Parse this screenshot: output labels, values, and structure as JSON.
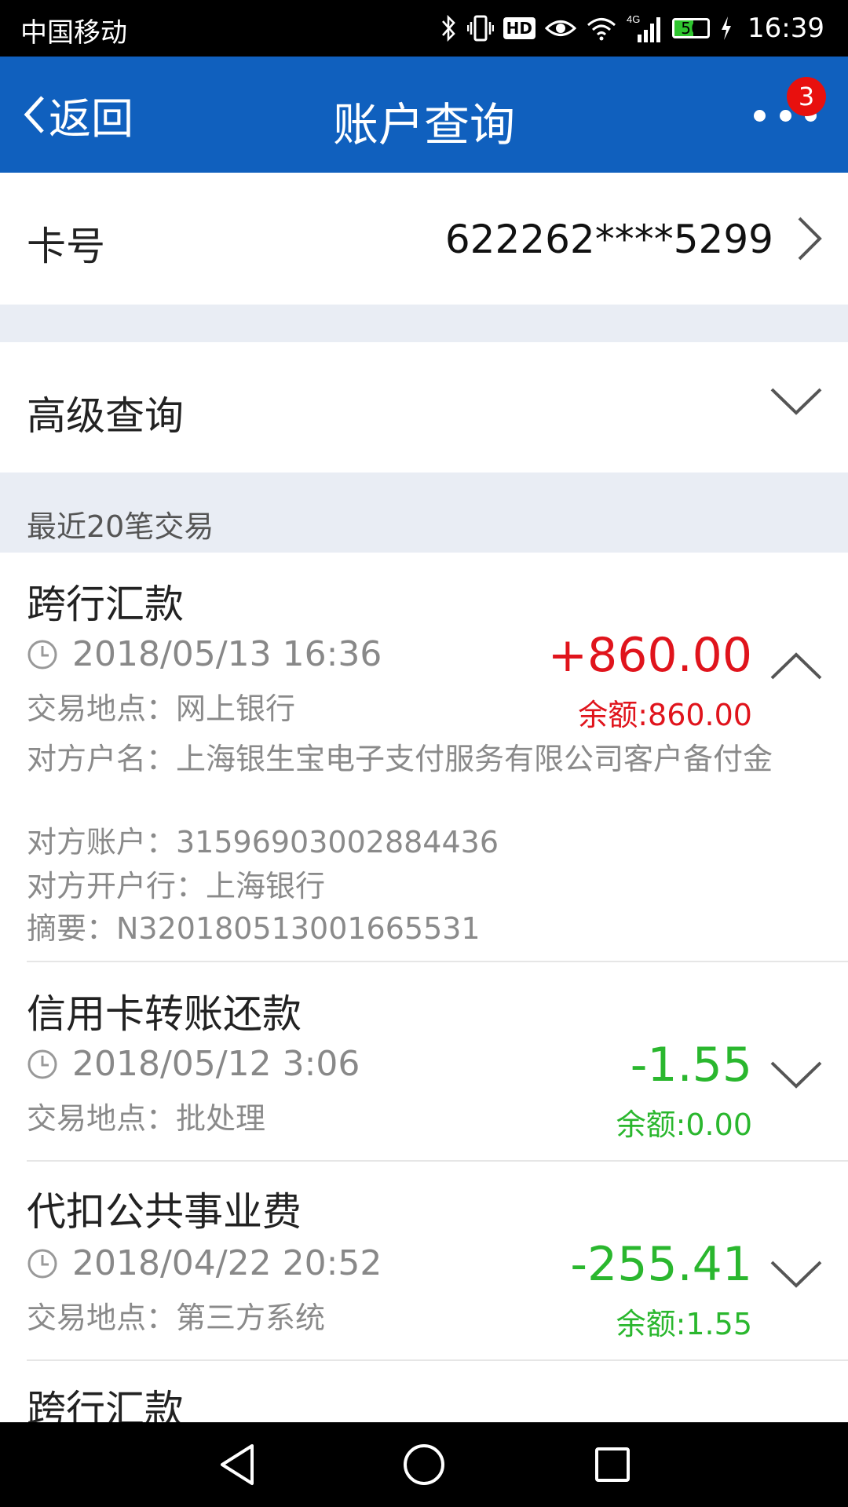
{
  "status_bar": {
    "carrier": "中国移动",
    "battery_level": "56",
    "battery_fraction": 0.56,
    "time": "16:39",
    "icons": [
      "bluetooth-icon",
      "vibrate-icon",
      "hd-icon",
      "eye-icon",
      "wifi-icon",
      "signal-4g-icon",
      "battery-icon",
      "charging-icon"
    ],
    "hd_label": "HD",
    "network_label": "4G"
  },
  "nav": {
    "back_label": "返回",
    "title": "账户查询",
    "badge_count": "3"
  },
  "card": {
    "label": "卡号",
    "number": "622262****5299"
  },
  "advanced": {
    "label": "高级查询"
  },
  "recent": {
    "label": "最近20笔交易"
  },
  "transactions": [
    {
      "title": "跨行汇款",
      "time": "2018/05/13 16:36",
      "amount": "+860.00",
      "balance": "余额:860.00",
      "location": "交易地点：网上银行",
      "counterparty_name": "对方户名：上海银生宝电子支付服务有限公司客户备付金",
      "counterparty_account": "对方账户：31596903002884436",
      "counterparty_bank": "对方开户行：上海银行",
      "memo": "摘要：N3201805130016655 31"
    },
    {
      "title": "信用卡转账还款",
      "time": "2018/05/12 3:06",
      "amount": "-1.55",
      "balance": "余额:0.00",
      "location": "交易地点：批处理"
    },
    {
      "title": "代扣公共事业费",
      "time": "2018/04/22 20:52",
      "amount": "-255.41",
      "balance": "余额:1.55",
      "location": "交易地点：第三方系统"
    },
    {
      "title": "跨行汇款"
    }
  ],
  "colors": {
    "nav_blue": "#1060be",
    "credit_red": "#e0141c",
    "debit_green": "#2ab72e",
    "band_gray": "#e9edf4",
    "badge_red": "#e8100e"
  }
}
